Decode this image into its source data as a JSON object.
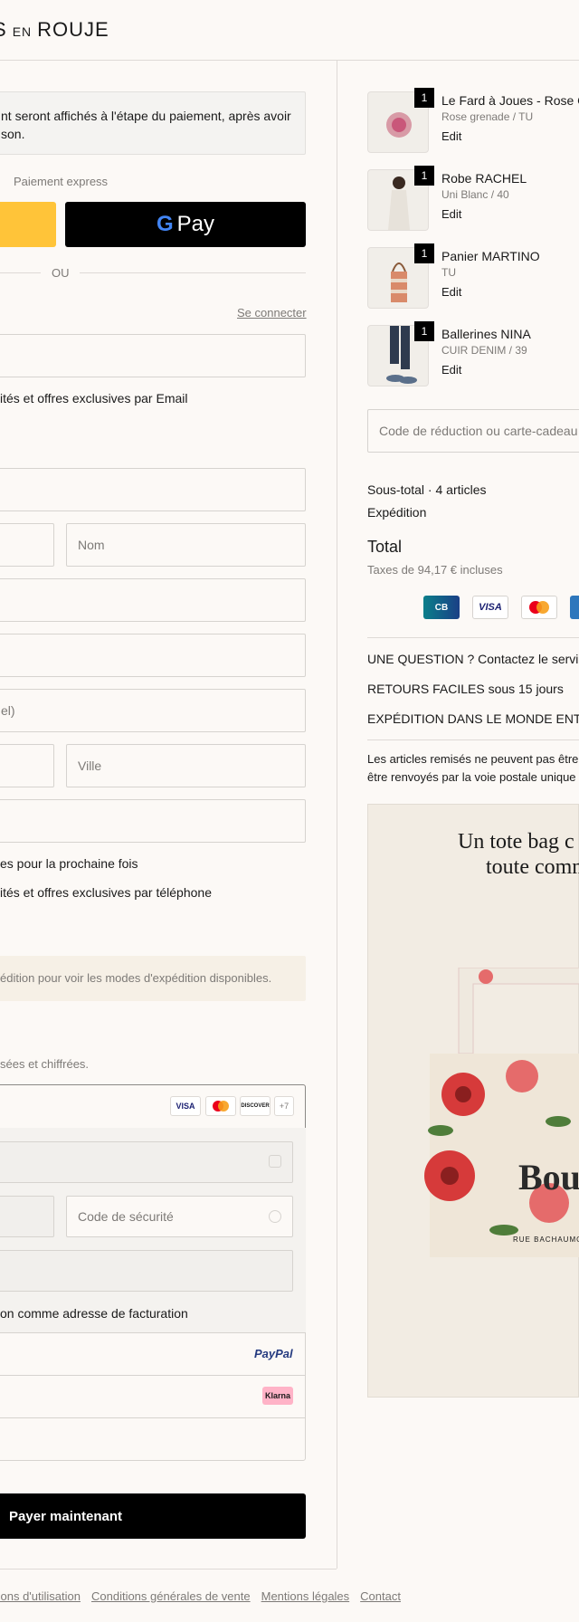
{
  "header": {
    "logo_part1": "S",
    "logo_part2": "EN",
    "logo_part3": "ROUJE"
  },
  "notice": {
    "line1": "nt seront affichés à l'étape du paiement, après avoir",
    "line2": "son."
  },
  "express": {
    "label": "Paiement express",
    "gpay_label": "Pay",
    "gpay_g": "G",
    "or_label": "OU"
  },
  "contact": {
    "login_link": "Se connecter",
    "newsletter_email": "ités et offres exclusives par Email"
  },
  "delivery": {
    "last_name_placeholder": "Nom",
    "phone_placeholder": "el)",
    "city_placeholder": "Ville",
    "save_info": "es pour la prochaine fois",
    "sms_offers": "ités et offres exclusives par téléphone"
  },
  "shipping": {
    "notice": "édition pour voir les modes d'expédition disponibles."
  },
  "payment": {
    "secure_note": "sées et chiffrées.",
    "card_badges": [
      "VISA",
      "MC",
      "DISCOVER",
      "+7"
    ],
    "security_code_placeholder": "Code de sécurité",
    "billing_same": "on comme adresse de facturation",
    "paypal": "PayPal",
    "klarna": "Klarna",
    "pay_button": "Payer maintenant"
  },
  "summary": {
    "items": [
      {
        "qty": "1",
        "name": "Le Fard à Joues - Rose Gre",
        "variant": "Rose grenade / TU",
        "edit": "Edit"
      },
      {
        "qty": "1",
        "name": "Robe RACHEL",
        "variant": "Uni Blanc / 40",
        "edit": "Edit"
      },
      {
        "qty": "1",
        "name": "Panier MARTINO",
        "variant": "TU",
        "edit": "Edit"
      },
      {
        "qty": "1",
        "name": "Ballerines NINA",
        "variant": "CUIR DENIM / 39",
        "edit": "Edit"
      }
    ],
    "discount_placeholder": "Code de réduction ou carte-cadeau",
    "subtotal_label": "Sous-total · 4 articles",
    "shipping_label": "Expédition",
    "total_label": "Total",
    "taxes": "Taxes de 94,17 € incluses",
    "payment_badges": [
      "CB",
      "VISA",
      "MC",
      "AMEX"
    ],
    "question": "UNE QUESTION ? Contactez le service",
    "returns_strong": "RETOURS FACILES",
    "returns_rest": "sous 15 jours",
    "worldwide": "EXPÉDITION DANS LE MONDE ENTIER",
    "disclaimer1": "Les articles remisés ne peuvent pas être",
    "disclaimer2": "être renvoyés par la voie postale unique",
    "promo_line1": "Un tote bag c",
    "promo_line2": "toute comm",
    "bag_text": "Bou",
    "bag_small": "RUE BACHAUMO"
  },
  "footer": {
    "links": [
      "tions d'utilisation",
      "Conditions générales de vente",
      "Mentions légales",
      "Contact"
    ]
  },
  "colors": {
    "accent_yellow": "#ffc439",
    "black": "#000000",
    "bg": "#fcf9f6",
    "ship_notice_bg": "#f6f0e6"
  }
}
